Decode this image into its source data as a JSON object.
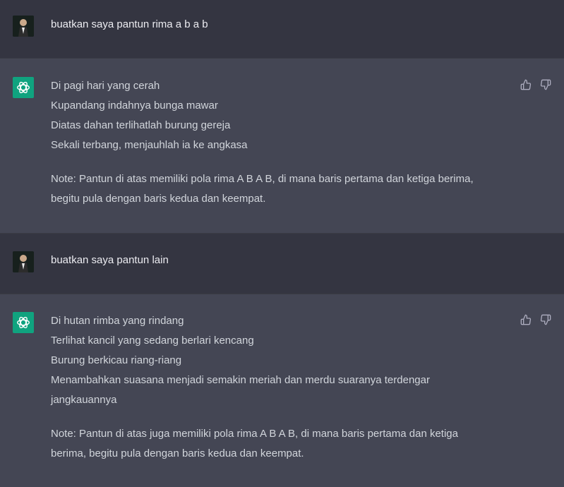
{
  "conversation": [
    {
      "role": "user",
      "text": "buatkan saya pantun rima a b a b"
    },
    {
      "role": "assistant",
      "lines": [
        "Di pagi hari yang cerah",
        "Kupandang indahnya bunga mawar",
        "Diatas dahan terlihatlah burung gereja",
        "Sekali terbang, menjauhlah ia ke angkasa"
      ],
      "note": [
        "Note: Pantun di atas memiliki pola rima A B A B, di mana baris pertama dan ketiga berima,",
        "begitu pula dengan baris kedua dan keempat."
      ]
    },
    {
      "role": "user",
      "text": "buatkan saya pantun lain"
    },
    {
      "role": "assistant",
      "lines": [
        "Di hutan rimba yang rindang",
        "Terlihat kancil yang sedang berlari kencang",
        "Burung berkicau riang-riang",
        "Menambahkan suasana menjadi semakin meriah dan merdu suaranya terdengar",
        "jangkauannya"
      ],
      "note": [
        "Note: Pantun di atas juga memiliki pola rima A B A B, di mana baris pertama dan ketiga",
        "berima, begitu pula dengan baris kedua dan keempat."
      ]
    }
  ],
  "icons": {
    "user_avatar": "user-avatar",
    "assistant_avatar": "openai-logo-icon",
    "thumbs_up": "thumbs-up-icon",
    "thumbs_down": "thumbs-down-icon"
  },
  "colors": {
    "user_bg": "#343541",
    "assistant_bg": "#444654",
    "brand": "#10a37f"
  }
}
